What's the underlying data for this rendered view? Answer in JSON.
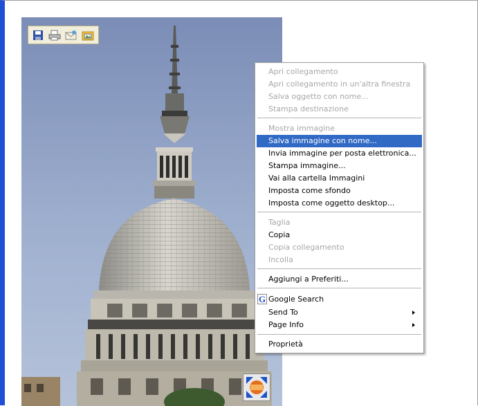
{
  "image": {
    "subject": "mole-antonelliana-photo"
  },
  "image_toolbar": {
    "buttons": [
      {
        "icon": "save-icon"
      },
      {
        "icon": "print-icon"
      },
      {
        "icon": "email-icon"
      },
      {
        "icon": "my-pictures-icon"
      }
    ]
  },
  "autosize": {
    "icon": "resize-arrows-icon"
  },
  "context_menu": {
    "items": [
      {
        "label": "Apri collegamento",
        "disabled": true
      },
      {
        "label": "Apri collegamento in un'altra finestra",
        "disabled": true
      },
      {
        "label": "Salva oggetto con nome...",
        "disabled": true
      },
      {
        "label": "Stampa destinazione",
        "disabled": true
      },
      {
        "label": "Mostra immagine",
        "disabled": true
      },
      {
        "label": "Salva immagine con nome...",
        "highlighted": true
      },
      {
        "label": "Invia immagine per posta elettronica..."
      },
      {
        "label": "Stampa immagine..."
      },
      {
        "label": "Vai alla cartella Immagini"
      },
      {
        "label": "Imposta come sfondo"
      },
      {
        "label": "Imposta come oggetto desktop..."
      },
      {
        "label": "Taglia",
        "disabled": true
      },
      {
        "label": "Copia"
      },
      {
        "label": "Copia collegamento",
        "disabled": true
      },
      {
        "label": "Incolla",
        "disabled": true
      },
      {
        "label": "Aggiungi a Preferiti..."
      },
      {
        "label": "Google Search",
        "icon": "google-icon"
      },
      {
        "label": "Send To",
        "submenu": true
      },
      {
        "label": "Page Info",
        "submenu": true
      },
      {
        "label": "Proprietà"
      }
    ]
  },
  "colors": {
    "highlight": "#316ac5",
    "disabled_text": "#a7a7a7",
    "window_border": "#1f4fd6"
  }
}
